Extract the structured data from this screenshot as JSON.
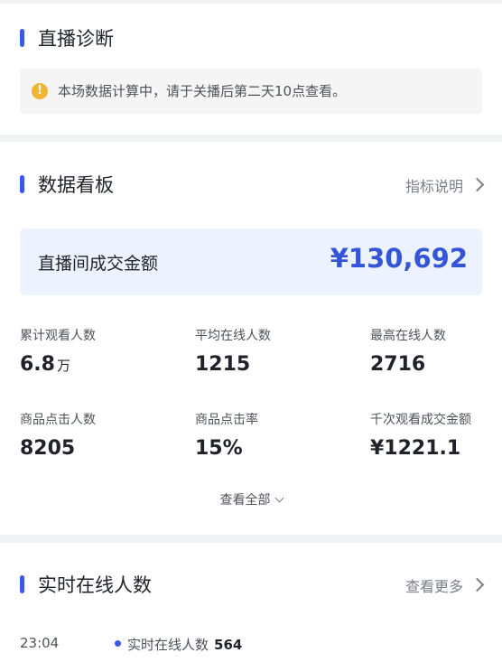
{
  "diagnosis": {
    "title": "直播诊断",
    "notice": "本场数据计算中，请于关播后第二天10点查看。"
  },
  "dashboard": {
    "title": "数据看板",
    "link": "指标说明",
    "gmv_label": "直播间成交金额",
    "gmv_value": "¥130,692",
    "metrics": [
      {
        "label": "累计观看人数",
        "value": "6.8",
        "unit": "万"
      },
      {
        "label": "平均在线人数",
        "value": "1215",
        "unit": ""
      },
      {
        "label": "最高在线人数",
        "value": "2716",
        "unit": ""
      },
      {
        "label": "商品点击人数",
        "value": "8205",
        "unit": ""
      },
      {
        "label": "商品点击率",
        "value": "15%",
        "unit": ""
      },
      {
        "label": "千次观看成交金额",
        "value": "¥1221.1",
        "unit": ""
      }
    ],
    "view_all": "查看全部"
  },
  "online": {
    "title": "实时在线人数",
    "link": "查看更多",
    "time": "23:04",
    "legend_label": "实时在线人数",
    "legend_value": "564"
  },
  "colors": {
    "accent": "#3b59e6",
    "gmv_value": "#3456d6",
    "warning": "#f2b531"
  }
}
